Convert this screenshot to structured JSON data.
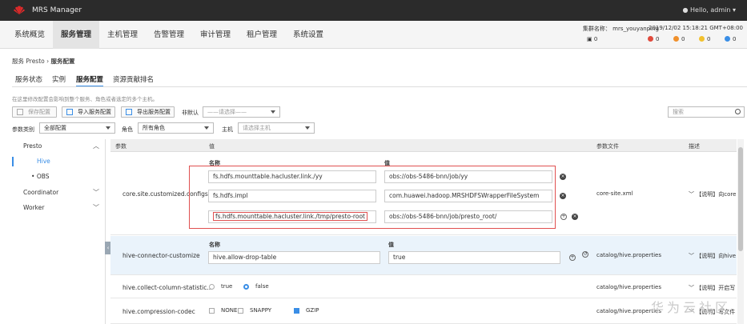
{
  "topbar": {
    "app_title": "MRS Manager",
    "user": "Hello, admin"
  },
  "nav": {
    "items": [
      "系统概览",
      "服务管理",
      "主机管理",
      "告警管理",
      "审计管理",
      "租户管理",
      "系统设置"
    ]
  },
  "status": {
    "cluster": "集群名称： mrs_youyanping",
    "datetime": "2019/12/02 15:18:21 GMT+08:00",
    "counts": [
      "0",
      "0",
      "0",
      "0",
      "0"
    ],
    "alarm_colors": [
      "#e04a3c",
      "#f0902c",
      "#f2c12e",
      "#3a8ee6"
    ]
  },
  "breadcrumb": {
    "parent": "服务 Presto",
    "sep": "›",
    "current": "服务配置"
  },
  "tabs": [
    "服务状态",
    "实例",
    "服务配置",
    "资源贡献排名"
  ],
  "hint": "在这里修改配置会影响到整个服务、角色或者选定的多个主机。",
  "toolbar": {
    "save": "保存配置",
    "import": "导入服务配置",
    "export": "导出服务配置",
    "nondefault_label": "非默认",
    "nondefault_value": "——请选择——",
    "search_placeholder": "搜索"
  },
  "filters": {
    "param_type_label": "参数类别",
    "param_type_value": "全部配置",
    "role_label": "角色",
    "role_value": "所有角色",
    "host_label": "主机",
    "host_placeholder": "请选择主机"
  },
  "sidebar": {
    "presto": "Presto",
    "hive": "Hive",
    "obs": "OBS",
    "coordinator": "Coordinator",
    "worker": "Worker"
  },
  "table": {
    "headers": {
      "param": "参数",
      "value": "值",
      "file": "参数文件",
      "desc": "描述"
    },
    "name_hdr": "名称",
    "val_hdr": "值",
    "row1": {
      "param": "core.site.customized.configs",
      "file": "core-site.xml",
      "desc": "【说明】向core",
      "pairs": [
        {
          "name": "fs.hdfs.mounttable.hacluster.link./yy",
          "value": "obs://obs-5486-bnn/job/yy"
        },
        {
          "name": "fs.hdfs.impl",
          "value": "com.huawei.hadoop.MRSHDFSWrapperFileSystem"
        },
        {
          "name": "fs.hdfs.mounttable.hacluster.link./tmp/presto-root",
          "value": "obs://obs-5486-bnn/job/presto_root/"
        }
      ]
    },
    "row2": {
      "param": "hive-connector-customize",
      "file": "catalog/hive.properties",
      "desc": "【说明】向hive",
      "name": "hive.allow-drop-table",
      "value": "true"
    },
    "row3": {
      "param": "hive.collect-column-statistic...",
      "file": "catalog/hive.properties",
      "desc": "【说明】开启写",
      "opt_true": "true",
      "opt_false": "false"
    },
    "row4": {
      "param": "hive.compression-codec",
      "file": "catalog/hive.properties",
      "desc": "【说明】写文件",
      "opts": [
        "NONE",
        "SNAPPY",
        "GZIP"
      ]
    }
  },
  "watermark": "华为云社区"
}
